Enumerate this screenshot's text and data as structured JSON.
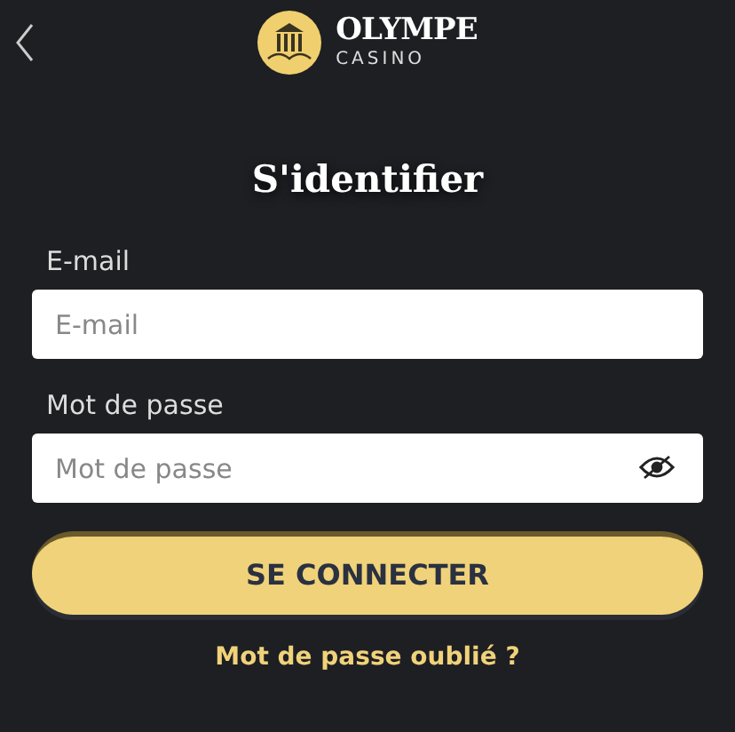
{
  "header": {
    "logo_name": "OLYMPE",
    "logo_sub": "CASINO"
  },
  "title": "S'identifier",
  "fields": [
    {
      "label": "E-mail",
      "placeholder": "E-mail",
      "kind": "text"
    },
    {
      "label": "Mot de passe",
      "placeholder": "Mot de passe",
      "kind": "password"
    }
  ],
  "submit": "SE CONNECTER",
  "forgot_link": "Mot de passe oublié ?"
}
